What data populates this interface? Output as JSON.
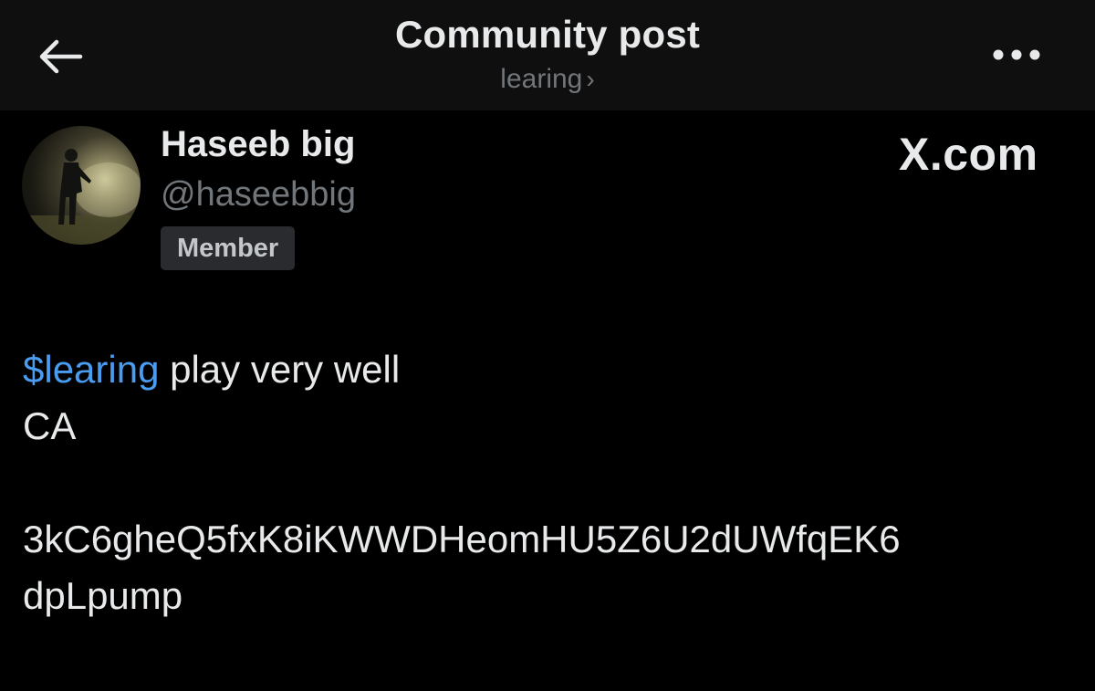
{
  "header": {
    "title": "Community post",
    "community": "learing",
    "chevron": "›"
  },
  "icons": {
    "back": "arrow-left-icon",
    "more": "ellipsis-icon"
  },
  "author": {
    "name": "Haseeb big",
    "handle": "@haseebbig",
    "badge": "Member"
  },
  "brand": "X.com",
  "post": {
    "cashtag": "$learing",
    "line1_rest": " play very well",
    "line2": "CA",
    "line3": "3kC6gheQ5fxK8iKWWDHeomHU5Z6U2dUWfqEK6",
    "line4": "dpLpump"
  },
  "colors": {
    "background": "#000000",
    "header_background": "#0f0f0f",
    "text": "#e7e9ea",
    "muted": "#71767b",
    "link": "#4a9cf0",
    "badge_background": "#2a2b2e"
  }
}
